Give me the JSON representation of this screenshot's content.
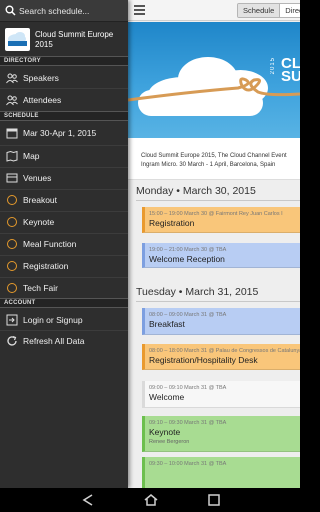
{
  "search": {
    "placeholder": "Search schedule..."
  },
  "event": {
    "name": "Cloud Summit Europe 2015",
    "logo_text": "CLOUD SUMMIT"
  },
  "drawer": {
    "sections": {
      "directory": "DIRECTORY",
      "schedule": "SCHEDULE",
      "account": "ACCOUNT"
    },
    "directory_items": [
      {
        "label": "Speakers",
        "icon": "speakers-icon"
      },
      {
        "label": "Attendees",
        "icon": "attendees-icon"
      }
    ],
    "schedule_items": [
      {
        "label": "Mar 30-Apr 1, 2015",
        "icon": "calendar-icon"
      },
      {
        "label": "Map",
        "icon": "map-icon"
      },
      {
        "label": "Venues",
        "icon": "venues-icon"
      },
      {
        "label": "Breakout",
        "icon": "circle-icon",
        "color": "#e59a2c"
      },
      {
        "label": "Keynote",
        "icon": "circle-icon",
        "color": "#e59a2c"
      },
      {
        "label": "Meal Function",
        "icon": "circle-icon",
        "color": "#e59a2c"
      },
      {
        "label": "Registration",
        "icon": "circle-icon",
        "color": "#e59a2c"
      },
      {
        "label": "Tech Fair",
        "icon": "circle-icon",
        "color": "#e59a2c"
      }
    ],
    "account_items": [
      {
        "label": "Login or Signup",
        "icon": "login-icon"
      },
      {
        "label": "Refresh All Data",
        "icon": "refresh-icon"
      }
    ]
  },
  "toolbar": {
    "tabs": [
      "Schedule",
      "Directory"
    ],
    "active_tab": "Schedule"
  },
  "banner": {
    "text_line1": "CL",
    "text_line2": "SU",
    "year": "2015"
  },
  "intro": {
    "line1": "Cloud Summit Europe 2015, The Cloud Channel Event",
    "line2": "Ingram Micro.  30 March - 1 April, Barcelona, Spain"
  },
  "days": [
    {
      "header": "Monday • March 30, 2015",
      "sessions": [
        {
          "time": "15:00 – 19:00 March 30 @ Fairmont Rey Juan Carlos I",
          "title": "Registration",
          "speaker": "",
          "color": "orange"
        },
        {
          "time": "19:00 – 21:00 March 30 @ TBA",
          "title": "Welcome Reception",
          "speaker": "",
          "color": "blue"
        }
      ]
    },
    {
      "header": "Tuesday • March 31, 2015",
      "sessions": [
        {
          "time": "08:00 – 09:00 March 31 @ TBA",
          "title": "Breakfast",
          "speaker": "",
          "color": "blue"
        },
        {
          "time": "08:00 – 18:00 March 31 @ Palau de Congressos de Catalunya",
          "title": "Registration/Hospitality Desk",
          "speaker": "",
          "color": "orange"
        },
        {
          "time": "09:00 – 09:10 March 31 @ TBA",
          "title": "Welcome",
          "speaker": "",
          "color": "white"
        },
        {
          "time": "09:10 – 09:30 March 31 @ TBA",
          "title": "Keynote",
          "speaker": "Renee Bergeron",
          "color": "green"
        },
        {
          "time": "09:30 – 10:00 March 31 @ TBA",
          "title": "",
          "speaker": "",
          "color": "green"
        }
      ]
    }
  ],
  "colors": {
    "drawer_bg": "#2e2e2e",
    "accent_orange": "#f9c67a",
    "accent_blue": "#b8cdf3",
    "accent_green": "#a8dc92",
    "circle_icon": "#e59a2c"
  },
  "system_nav": [
    "back-icon",
    "home-icon",
    "recents-icon"
  ]
}
